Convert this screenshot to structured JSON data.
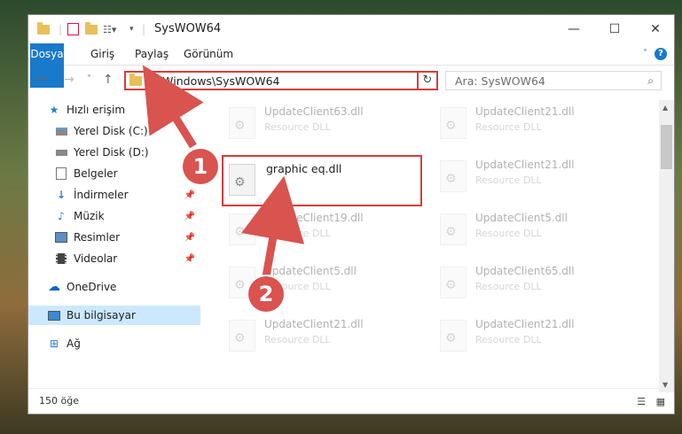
{
  "window": {
    "title": "SysWOW64",
    "controls": {
      "minimize": "—",
      "maximize": "☐",
      "close": "✕"
    }
  },
  "ribbon": {
    "tabs": [
      "Dosya",
      "Giriş",
      "Paylaş",
      "Görünüm"
    ],
    "help": "?"
  },
  "nav": {
    "back": "←",
    "forward": "→",
    "recent": "˅",
    "up": "↑",
    "address": "C:\\Windows\\SysWOW64",
    "refresh": "↻",
    "search_placeholder": "Ara: SysWOW64"
  },
  "sidebar": {
    "items": [
      {
        "label": "Hızlı erişim",
        "icon": "star-icon"
      },
      {
        "label": "Yerel Disk (C:)",
        "icon": "drive-icon"
      },
      {
        "label": "Yerel Disk (D:)",
        "icon": "drive-icon"
      },
      {
        "label": "Belgeler",
        "icon": "document-icon"
      },
      {
        "label": "İndirmeler",
        "icon": "download-icon"
      },
      {
        "label": "Müzik",
        "icon": "music-icon"
      },
      {
        "label": "Resimler",
        "icon": "pictures-icon"
      },
      {
        "label": "Videolar",
        "icon": "video-icon"
      },
      {
        "label": "OneDrive",
        "icon": "cloud-icon"
      },
      {
        "label": "Bu bilgisayar",
        "icon": "computer-icon"
      },
      {
        "label": "Ağ",
        "icon": "network-icon"
      }
    ]
  },
  "files": [
    {
      "name": "UpdateClient63.dll",
      "type": "Resource DLL"
    },
    {
      "name": "UpdateClient21.dll",
      "type": "Resource DLL"
    },
    {
      "name": "graphic eq.dll",
      "type": ""
    },
    {
      "name": "UpdateClient21.dll",
      "type": "Resource DLL"
    },
    {
      "name": "UpdateClient19.dll",
      "type": "Resource DLL"
    },
    {
      "name": "UpdateClient5.dll",
      "type": "Resource DLL"
    },
    {
      "name": "UpdateClient5.dll",
      "type": "Resource DLL"
    },
    {
      "name": "UpdateClient65.dll",
      "type": "Resource DLL"
    },
    {
      "name": "UpdateClient21.dll",
      "type": "Resource DLL"
    },
    {
      "name": "UpdateClient21.dll",
      "type": "Resource DLL"
    }
  ],
  "status": {
    "count": "150 öğe"
  },
  "annotations": {
    "step1": "1",
    "step2": "2"
  },
  "colors": {
    "accent": "#1979ca",
    "highlight": "#d63c3c",
    "badge": "#d9534f"
  }
}
